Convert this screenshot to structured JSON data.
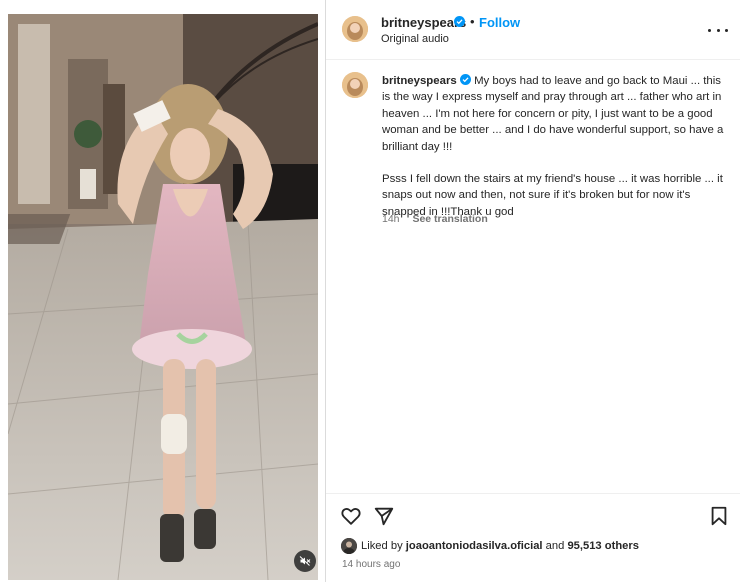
{
  "post": {
    "username": "britneyspears",
    "dot": "•",
    "follow_label": "Follow",
    "audio_label": "Original audio"
  },
  "caption": {
    "username": "britneyspears",
    "paragraph1": "My boys had to leave and go back to Maui ... this is the way I express myself and pray through art ... father who art in heaven ... I'm not here for concern or pity, I just want to be a good woman and be better ... and I do have wonderful support, so have a brilliant day !!!",
    "paragraph2": "Psss I fell down the stairs at my friend's house ... it was horrible ... it snaps out now and then, not sure if it's broken but for now it's snapped in !!!Thank u god",
    "time": "14h",
    "see_translation": "See translation"
  },
  "likes": {
    "prefix": "Liked by",
    "user": "joaoantoniodasilva.oficial",
    "conjunction": "and",
    "count": "95,513 others"
  },
  "timestamp": "14 hours ago",
  "colors": {
    "accent": "#0095f6",
    "verified": "#0095f6",
    "text": "#262626",
    "muted": "#737373"
  },
  "icons": {
    "like": "heart-icon",
    "share": "paper-plane-icon",
    "save": "bookmark-icon",
    "more": "more-options-icon",
    "mute": "speaker-muted-icon"
  }
}
